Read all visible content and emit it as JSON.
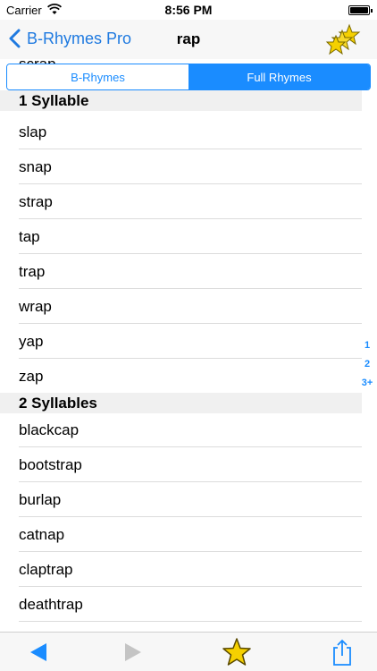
{
  "status_bar": {
    "carrier": "Carrier",
    "time": "8:56 PM"
  },
  "nav": {
    "back_label": "B-Rhymes Pro",
    "title": "rap",
    "favorites_icon": "stars-icon"
  },
  "segmented": {
    "options": [
      "B-Rhymes",
      "Full Rhymes"
    ],
    "selected": "Full Rhymes"
  },
  "list": {
    "peek_word": "scrap",
    "sections": [
      {
        "header": "1 Syllable",
        "words": [
          "slap",
          "snap",
          "strap",
          "tap",
          "trap",
          "wrap",
          "yap",
          "zap"
        ]
      },
      {
        "header": "2 Syllables",
        "words": [
          "blackcap",
          "bootstrap",
          "burlap",
          "catnap",
          "claptrap",
          "deathtrap"
        ]
      }
    ]
  },
  "index": [
    "1",
    "2",
    "3+"
  ],
  "toolbar": {
    "buttons": [
      "back-arrow-icon",
      "forward-arrow-icon",
      "star-icon",
      "share-icon"
    ]
  },
  "colors": {
    "accent": "#1a8cff",
    "star": "#f5d000"
  }
}
